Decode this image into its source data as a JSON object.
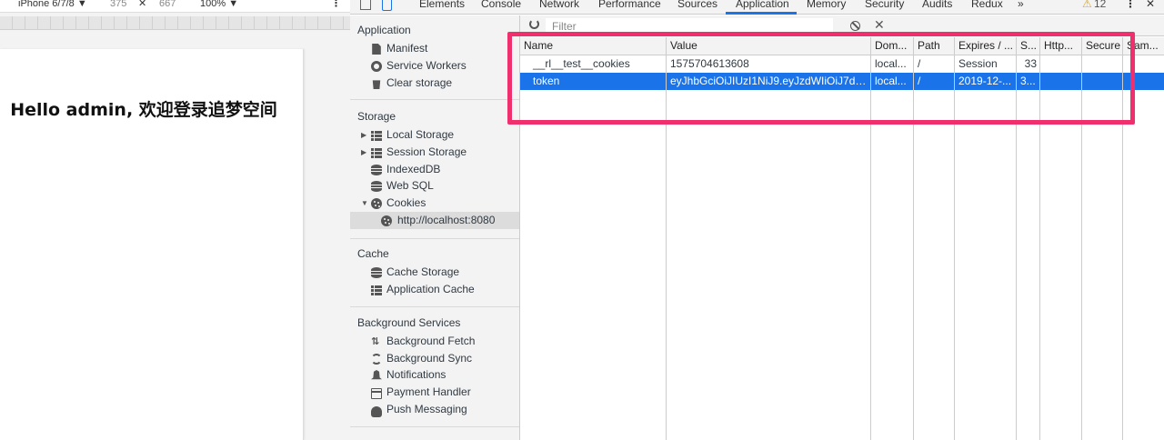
{
  "device_toolbar": {
    "device": "iPhone 6/7/8 ▼",
    "width": "375",
    "times": "✕",
    "height": "667",
    "zoom": "100% ▼",
    "more": "⋮"
  },
  "page": {
    "greeting": "Hello admin, 欢迎登录追梦空间"
  },
  "devtools": {
    "tabs": [
      "Elements",
      "Console",
      "Network",
      "Performance",
      "Sources",
      "Application",
      "Memory",
      "Security",
      "Audits",
      "Redux"
    ],
    "active_tab": "Application",
    "overflow": "»",
    "warning_count": "12",
    "warning_icon": "⚠",
    "menu": "⋮",
    "close": "✕"
  },
  "sidebar": {
    "application": {
      "title": "Application",
      "items": [
        {
          "label": "Manifest",
          "icon": "document-icon"
        },
        {
          "label": "Service Workers",
          "icon": "gear-icon"
        },
        {
          "label": "Clear storage",
          "icon": "trash-icon"
        }
      ]
    },
    "storage": {
      "title": "Storage",
      "items": [
        {
          "label": "Local Storage",
          "icon": "grid-icon"
        },
        {
          "label": "Session Storage",
          "icon": "grid-icon"
        },
        {
          "label": "IndexedDB",
          "icon": "database-icon"
        },
        {
          "label": "Web SQL",
          "icon": "database-icon"
        },
        {
          "label": "Cookies",
          "icon": "cookie-icon"
        },
        {
          "label": "http://localhost:8080",
          "icon": "cookie-icon"
        }
      ]
    },
    "cache": {
      "title": "Cache",
      "items": [
        {
          "label": "Cache Storage",
          "icon": "database-icon"
        },
        {
          "label": "Application Cache",
          "icon": "grid-icon"
        }
      ]
    },
    "background": {
      "title": "Background Services",
      "items": [
        {
          "label": "Background Fetch",
          "icon": "up-down-icon"
        },
        {
          "label": "Background Sync",
          "icon": "sync-icon"
        },
        {
          "label": "Notifications",
          "icon": "bell-icon"
        },
        {
          "label": "Payment Handler",
          "icon": "card-icon"
        },
        {
          "label": "Push Messaging",
          "icon": "cloud-icon"
        }
      ]
    }
  },
  "filter": {
    "placeholder": "Filter"
  },
  "cookies": {
    "columns": [
      "Name",
      "Value",
      "Dom...",
      "Path",
      "Expires / ...",
      "S...",
      "Http...",
      "Secure",
      "Sam..."
    ],
    "rows": [
      [
        "__rl__test__cookies",
        "1575704613608",
        "local...",
        "/",
        "Session",
        "33",
        "",
        "",
        ""
      ],
      [
        "token",
        "eyJhbGciOiJIUzI1NiJ9.eyJzdWIiOiJ7dX...",
        "local...",
        "/",
        "2019-12-...",
        "3...",
        "",
        "",
        ""
      ]
    ],
    "selected_row": 1
  },
  "colors": {
    "accent": "#1a73e8",
    "highlight": "#f0306e",
    "panel_bg": "#f3f3f3"
  }
}
